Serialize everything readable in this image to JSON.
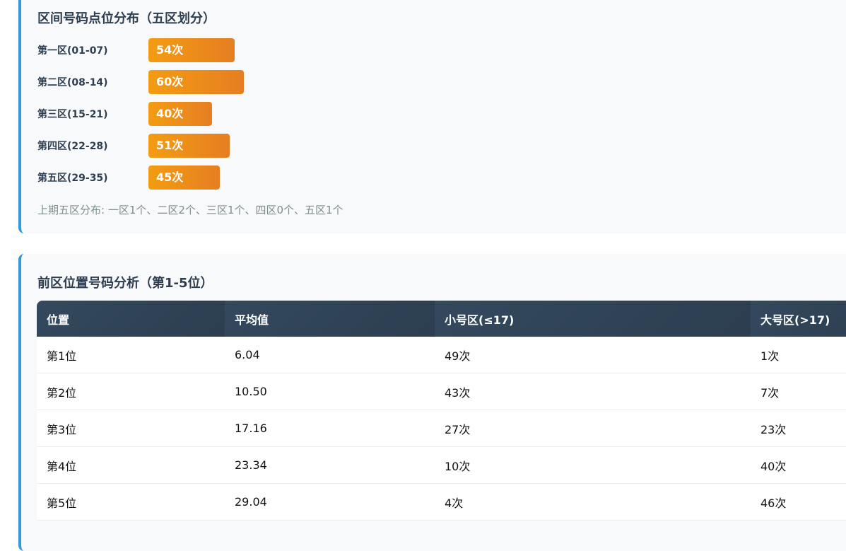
{
  "zone_card": {
    "title": "区间号码点位分布（五区划分）",
    "zones": [
      {
        "label": "第一区(01-07)",
        "count": 54,
        "text": "54次"
      },
      {
        "label": "第二区(08-14)",
        "count": 60,
        "text": "60次"
      },
      {
        "label": "第三区(15-21)",
        "count": 40,
        "text": "40次"
      },
      {
        "label": "第四区(22-28)",
        "count": 51,
        "text": "51次"
      },
      {
        "label": "第五区(29-35)",
        "count": 45,
        "text": "45次"
      }
    ],
    "note": "上期五区分布: 一区1个、二区2个、三区1个、四区0个、五区1个"
  },
  "position_card": {
    "title": "前区位置号码分析（第1-5位）",
    "headers": [
      "位置",
      "平均值",
      "小号区(≤17)",
      "大号区(>17)"
    ],
    "rows": [
      [
        "第1位",
        "6.04",
        "49次",
        "1次"
      ],
      [
        "第2位",
        "10.50",
        "43次",
        "7次"
      ],
      [
        "第3位",
        "17.16",
        "27次",
        "23次"
      ],
      [
        "第4位",
        "23.34",
        "10次",
        "40次"
      ],
      [
        "第5位",
        "29.04",
        "4次",
        "46次"
      ]
    ]
  },
  "colors": {
    "accent": "#3498db",
    "bar_start": "#f39c12",
    "bar_end": "#e67e22",
    "header": "#2c3e50"
  }
}
